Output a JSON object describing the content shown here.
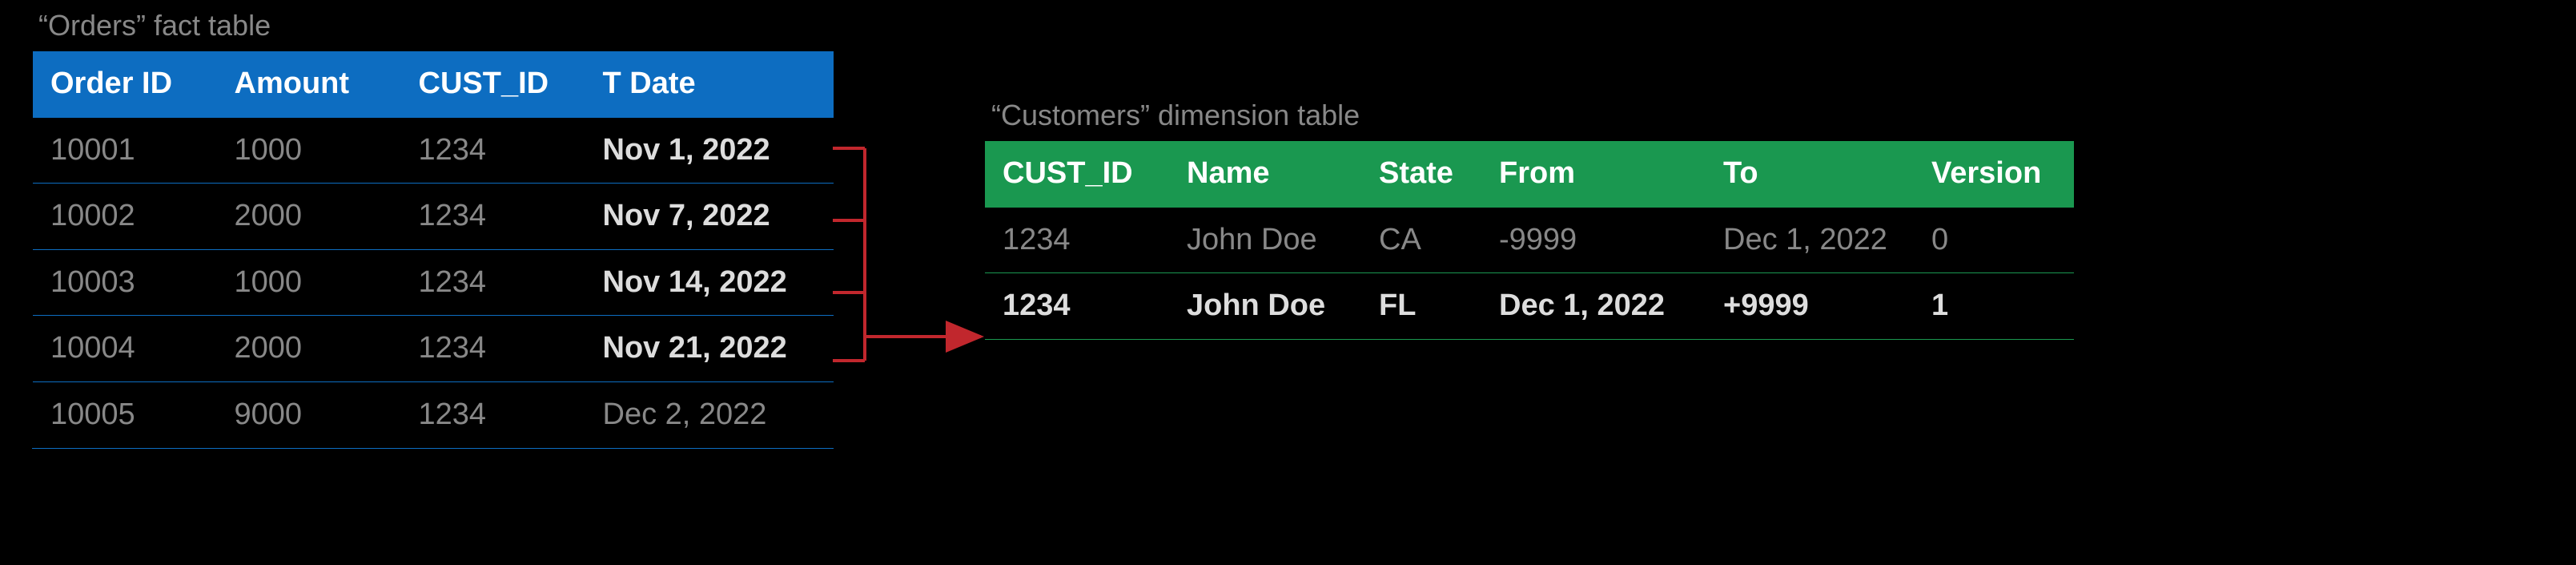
{
  "orders": {
    "caption": "“Orders” fact table",
    "columns": [
      "Order ID",
      "Amount",
      "CUST_ID",
      "T Date"
    ],
    "rows": [
      {
        "order_id": "10001",
        "amount": "1000",
        "cust_id": "1234",
        "t_date": "Nov 1, 2022",
        "date_bold": true
      },
      {
        "order_id": "10002",
        "amount": "2000",
        "cust_id": "1234",
        "t_date": "Nov 7, 2022",
        "date_bold": true
      },
      {
        "order_id": "10003",
        "amount": "1000",
        "cust_id": "1234",
        "t_date": "Nov 14, 2022",
        "date_bold": true
      },
      {
        "order_id": "10004",
        "amount": "2000",
        "cust_id": "1234",
        "t_date": "Nov 21, 2022",
        "date_bold": true
      },
      {
        "order_id": "10005",
        "amount": "9000",
        "cust_id": "1234",
        "t_date": "Dec 2, 2022",
        "date_bold": false
      }
    ]
  },
  "customers": {
    "caption": "“Customers” dimension table",
    "columns": [
      "CUST_ID",
      "Name",
      "State",
      "From",
      "To",
      "Version"
    ],
    "rows": [
      {
        "cust_id": "1234",
        "name": "John Doe",
        "state": "CA",
        "from": "-9999",
        "to": "Dec 1, 2022",
        "version": "0",
        "highlight": false
      },
      {
        "cust_id": "1234",
        "name": "John Doe",
        "state": "FL",
        "from": "Dec 1, 2022",
        "to": "+9999",
        "version": "1",
        "highlight": true
      }
    ]
  },
  "arrow_color": "#c1272d"
}
